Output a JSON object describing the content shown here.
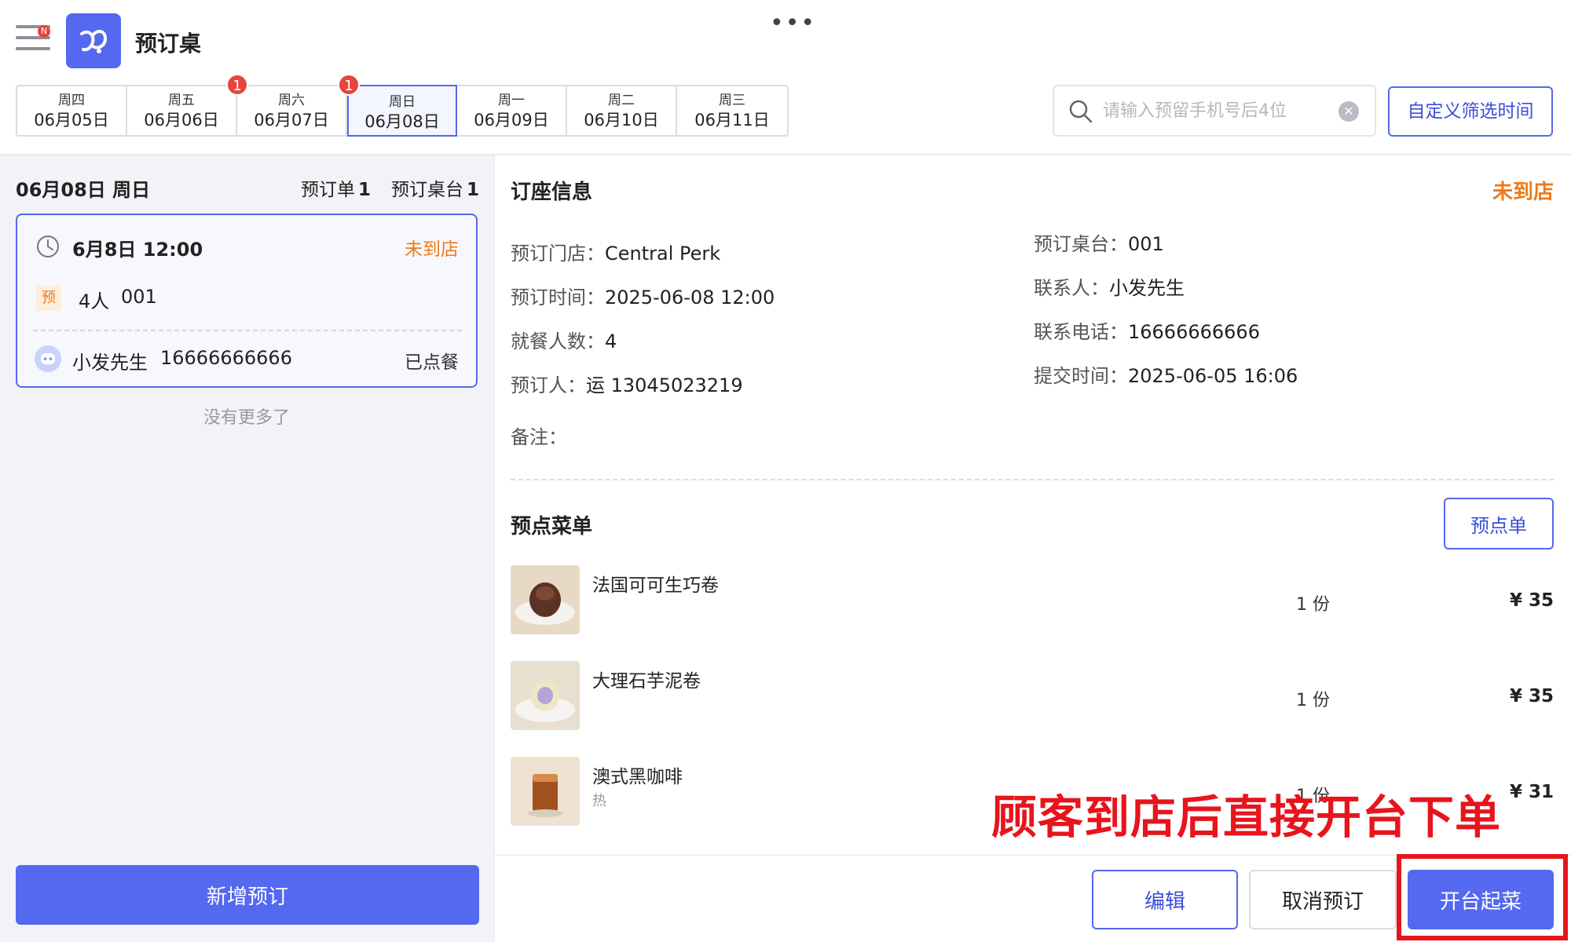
{
  "app": {
    "title": "预订桌",
    "menu_badge": "N"
  },
  "day_tabs": [
    {
      "weekday": "周四",
      "date": "06月05日",
      "badge": ""
    },
    {
      "weekday": "周五",
      "date": "06月06日",
      "badge": ""
    },
    {
      "weekday": "周六",
      "date": "06月07日",
      "badge": "1"
    },
    {
      "weekday": "周日",
      "date": "06月08日",
      "badge": "1",
      "active": true
    },
    {
      "weekday": "周一",
      "date": "06月09日",
      "badge": ""
    },
    {
      "weekday": "周二",
      "date": "06月10日",
      "badge": ""
    },
    {
      "weekday": "周三",
      "date": "06月11日",
      "badge": ""
    }
  ],
  "search": {
    "placeholder": "请输入预留手机号后4位",
    "value": ""
  },
  "filter_label": "自定义筛选时间",
  "left": {
    "date_header": "06月08日 周日",
    "order_count_label": "预订单",
    "order_count": "1",
    "table_count_label": "预订桌台",
    "table_count": "1",
    "card": {
      "time": "6月8日 12:00",
      "status": "未到店",
      "tag": "预",
      "people": "4人",
      "table": "001",
      "name": "小发先生",
      "phone": "16666666666",
      "ordered": "已点餐"
    },
    "no_more": "没有更多了",
    "add_label": "新增预订"
  },
  "detail": {
    "title": "订座信息",
    "status": "未到店",
    "left_fields": [
      {
        "label": "预订门店：",
        "value": "Central Perk"
      },
      {
        "label": "预订时间：",
        "value": "2025-06-08 12:00"
      },
      {
        "label": "就餐人数：",
        "value": "4"
      },
      {
        "label": "预订人：",
        "value": "运 13045023219"
      }
    ],
    "right_fields": [
      {
        "label": "预订桌台：",
        "value": "001"
      },
      {
        "label": "联系人：",
        "value": "小发先生"
      },
      {
        "label": "联系电话：",
        "value": "16666666666"
      },
      {
        "label": "提交时间：",
        "value": "2025-06-05 16:06"
      }
    ],
    "remark_label": "备注：",
    "remark_value": ""
  },
  "menu": {
    "title": "预点菜单",
    "preorder_label": "预点单",
    "items": [
      {
        "name": "法国可可生巧卷",
        "sub": "",
        "qty": "1 份",
        "price": "¥ 35"
      },
      {
        "name": "大理石芋泥卷",
        "sub": "",
        "qty": "1 份",
        "price": "¥ 35"
      },
      {
        "name": "澳式黑咖啡",
        "sub": "热",
        "qty": "1 份",
        "price": "¥ 31"
      }
    ]
  },
  "actions": {
    "edit": "编辑",
    "cancel": "取消预订",
    "open": "开台起菜"
  },
  "annotation": "顾客到店后直接开台下单",
  "colors": {
    "accent": "#5568f0",
    "warning": "#f07a1a",
    "badge": "#e8453c",
    "annotation": "#e8141c"
  }
}
